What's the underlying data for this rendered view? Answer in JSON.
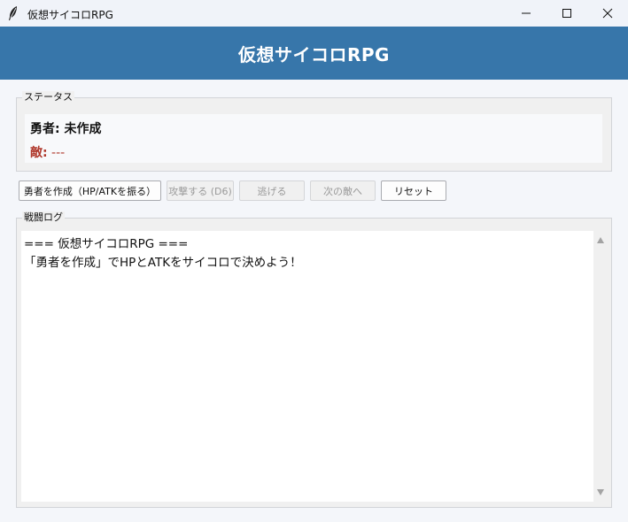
{
  "window": {
    "title": "仮想サイコロRPG",
    "icons": {
      "app": "feather-icon",
      "minimize": "minimize-icon",
      "maximize": "maximize-icon",
      "close": "close-icon"
    }
  },
  "header": {
    "title": "仮想サイコロRPG",
    "background": "#3776aa"
  },
  "status": {
    "group_label": "ステータス",
    "hero_text": "勇者: 未作成",
    "enemy_label": "敵:",
    "enemy_value": " ---",
    "enemy_color": "#b03a2e"
  },
  "buttons": {
    "create_hero": "勇者を作成（HP/ATKを振る）",
    "attack": "攻撃する (D6)",
    "flee": "逃げる",
    "next_enemy": "次の敵へ",
    "reset": "リセット"
  },
  "log": {
    "group_label": "戦闘ログ",
    "lines": [
      "=== 仮想サイコロRPG ===",
      "「勇者を作成」でHPとATKをサイコロで決めよう！"
    ]
  }
}
